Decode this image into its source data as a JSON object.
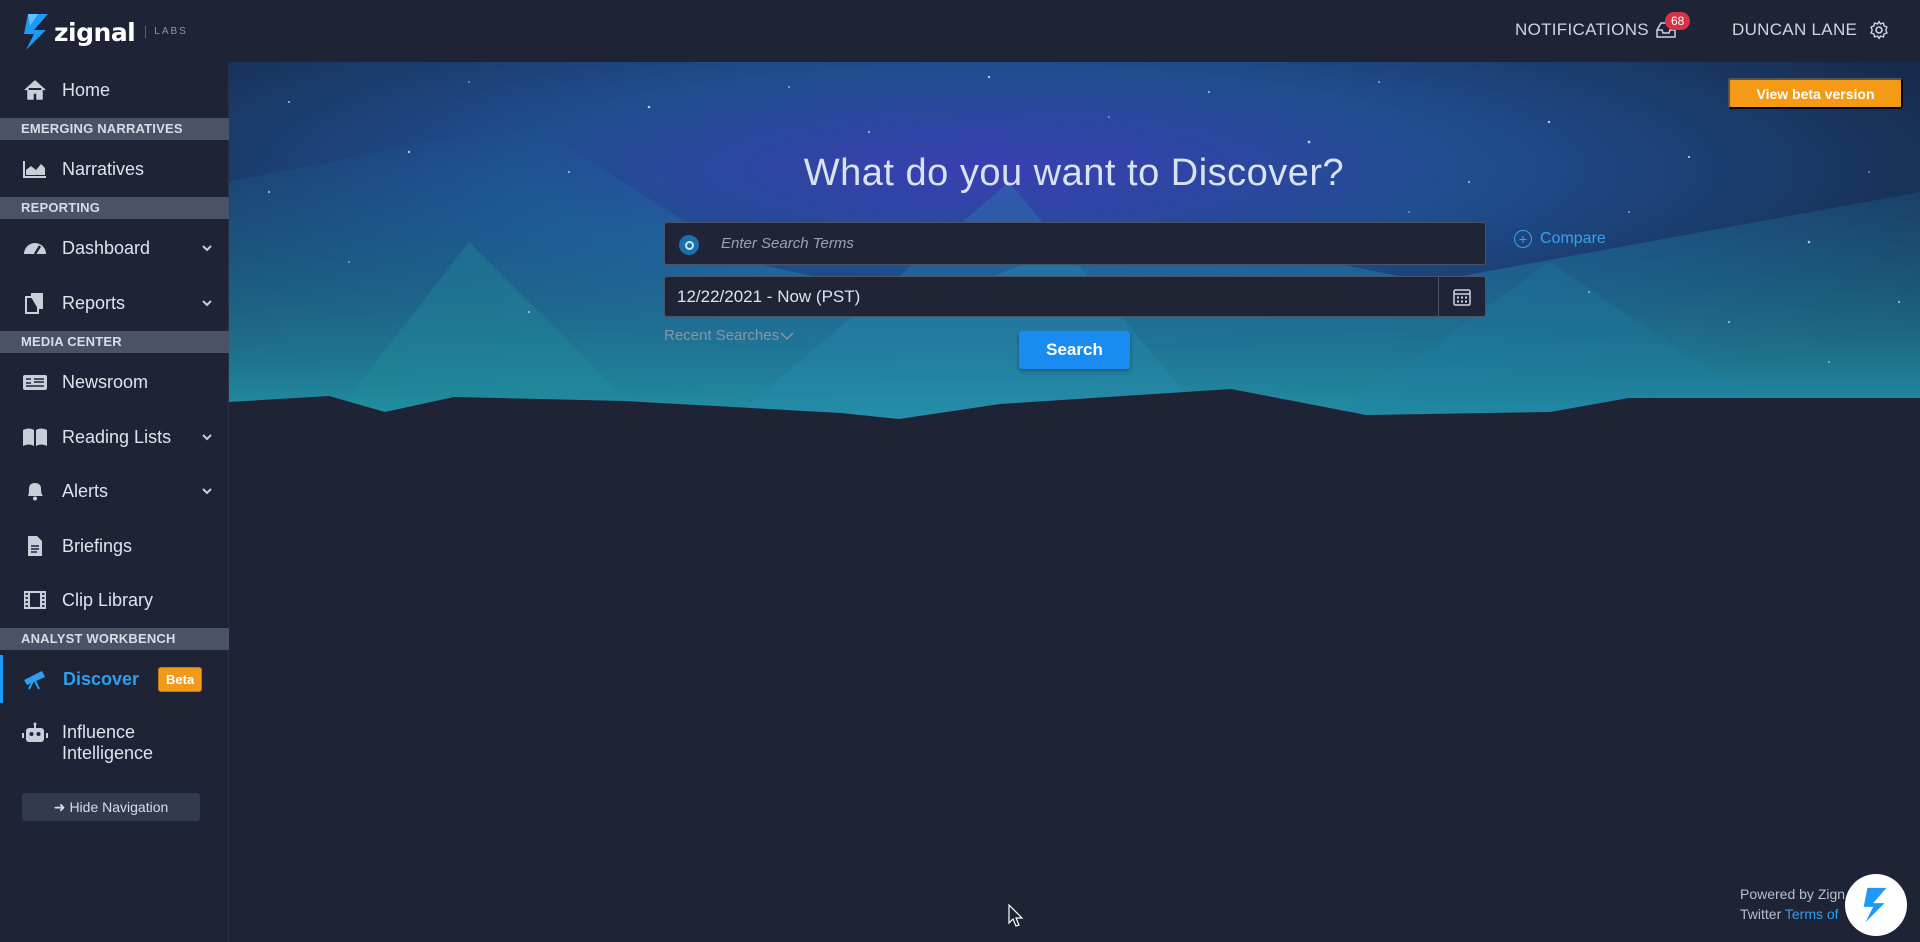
{
  "brand": {
    "name": "zignal",
    "sub": "LABS",
    "accent": "#1e9af5"
  },
  "topbar": {
    "notifications_label": "NOTIFICATIONS",
    "notifications_count": "68",
    "user_name": "DUNCAN LANE"
  },
  "sidebar": {
    "home": "Home",
    "section_emerging": "EMERGING NARRATIVES",
    "narratives": "Narratives",
    "section_reporting": "REPORTING",
    "dashboard": "Dashboard",
    "reports": "Reports",
    "section_media": "MEDIA CENTER",
    "newsroom": "Newsroom",
    "reading_lists": "Reading Lists",
    "alerts": "Alerts",
    "briefings": "Briefings",
    "clip_library": "Clip Library",
    "section_analyst": "ANALYST WORKBENCH",
    "discover": "Discover",
    "discover_badge": "Beta",
    "influence_line1": "Influence",
    "influence_line2": "Intelligence",
    "hide_nav": "Hide Navigation"
  },
  "main": {
    "beta_button": "View beta version",
    "headline": "What do you want to Discover?",
    "search_placeholder": "Enter Search Terms",
    "compare_label": "Compare",
    "date_range": "12/22/2021 - Now (PST)",
    "recent_searches": "Recent Searches",
    "search_button": "Search"
  },
  "footer": {
    "powered_by": "Powered by Zign",
    "twitter": "Twitter",
    "terms": "Terms of"
  },
  "colors": {
    "background": "#1e2436",
    "section_header": "#4a5268",
    "primary_blue": "#1a8bf0",
    "orange": "#f59a14",
    "badge_red": "#d63347"
  }
}
